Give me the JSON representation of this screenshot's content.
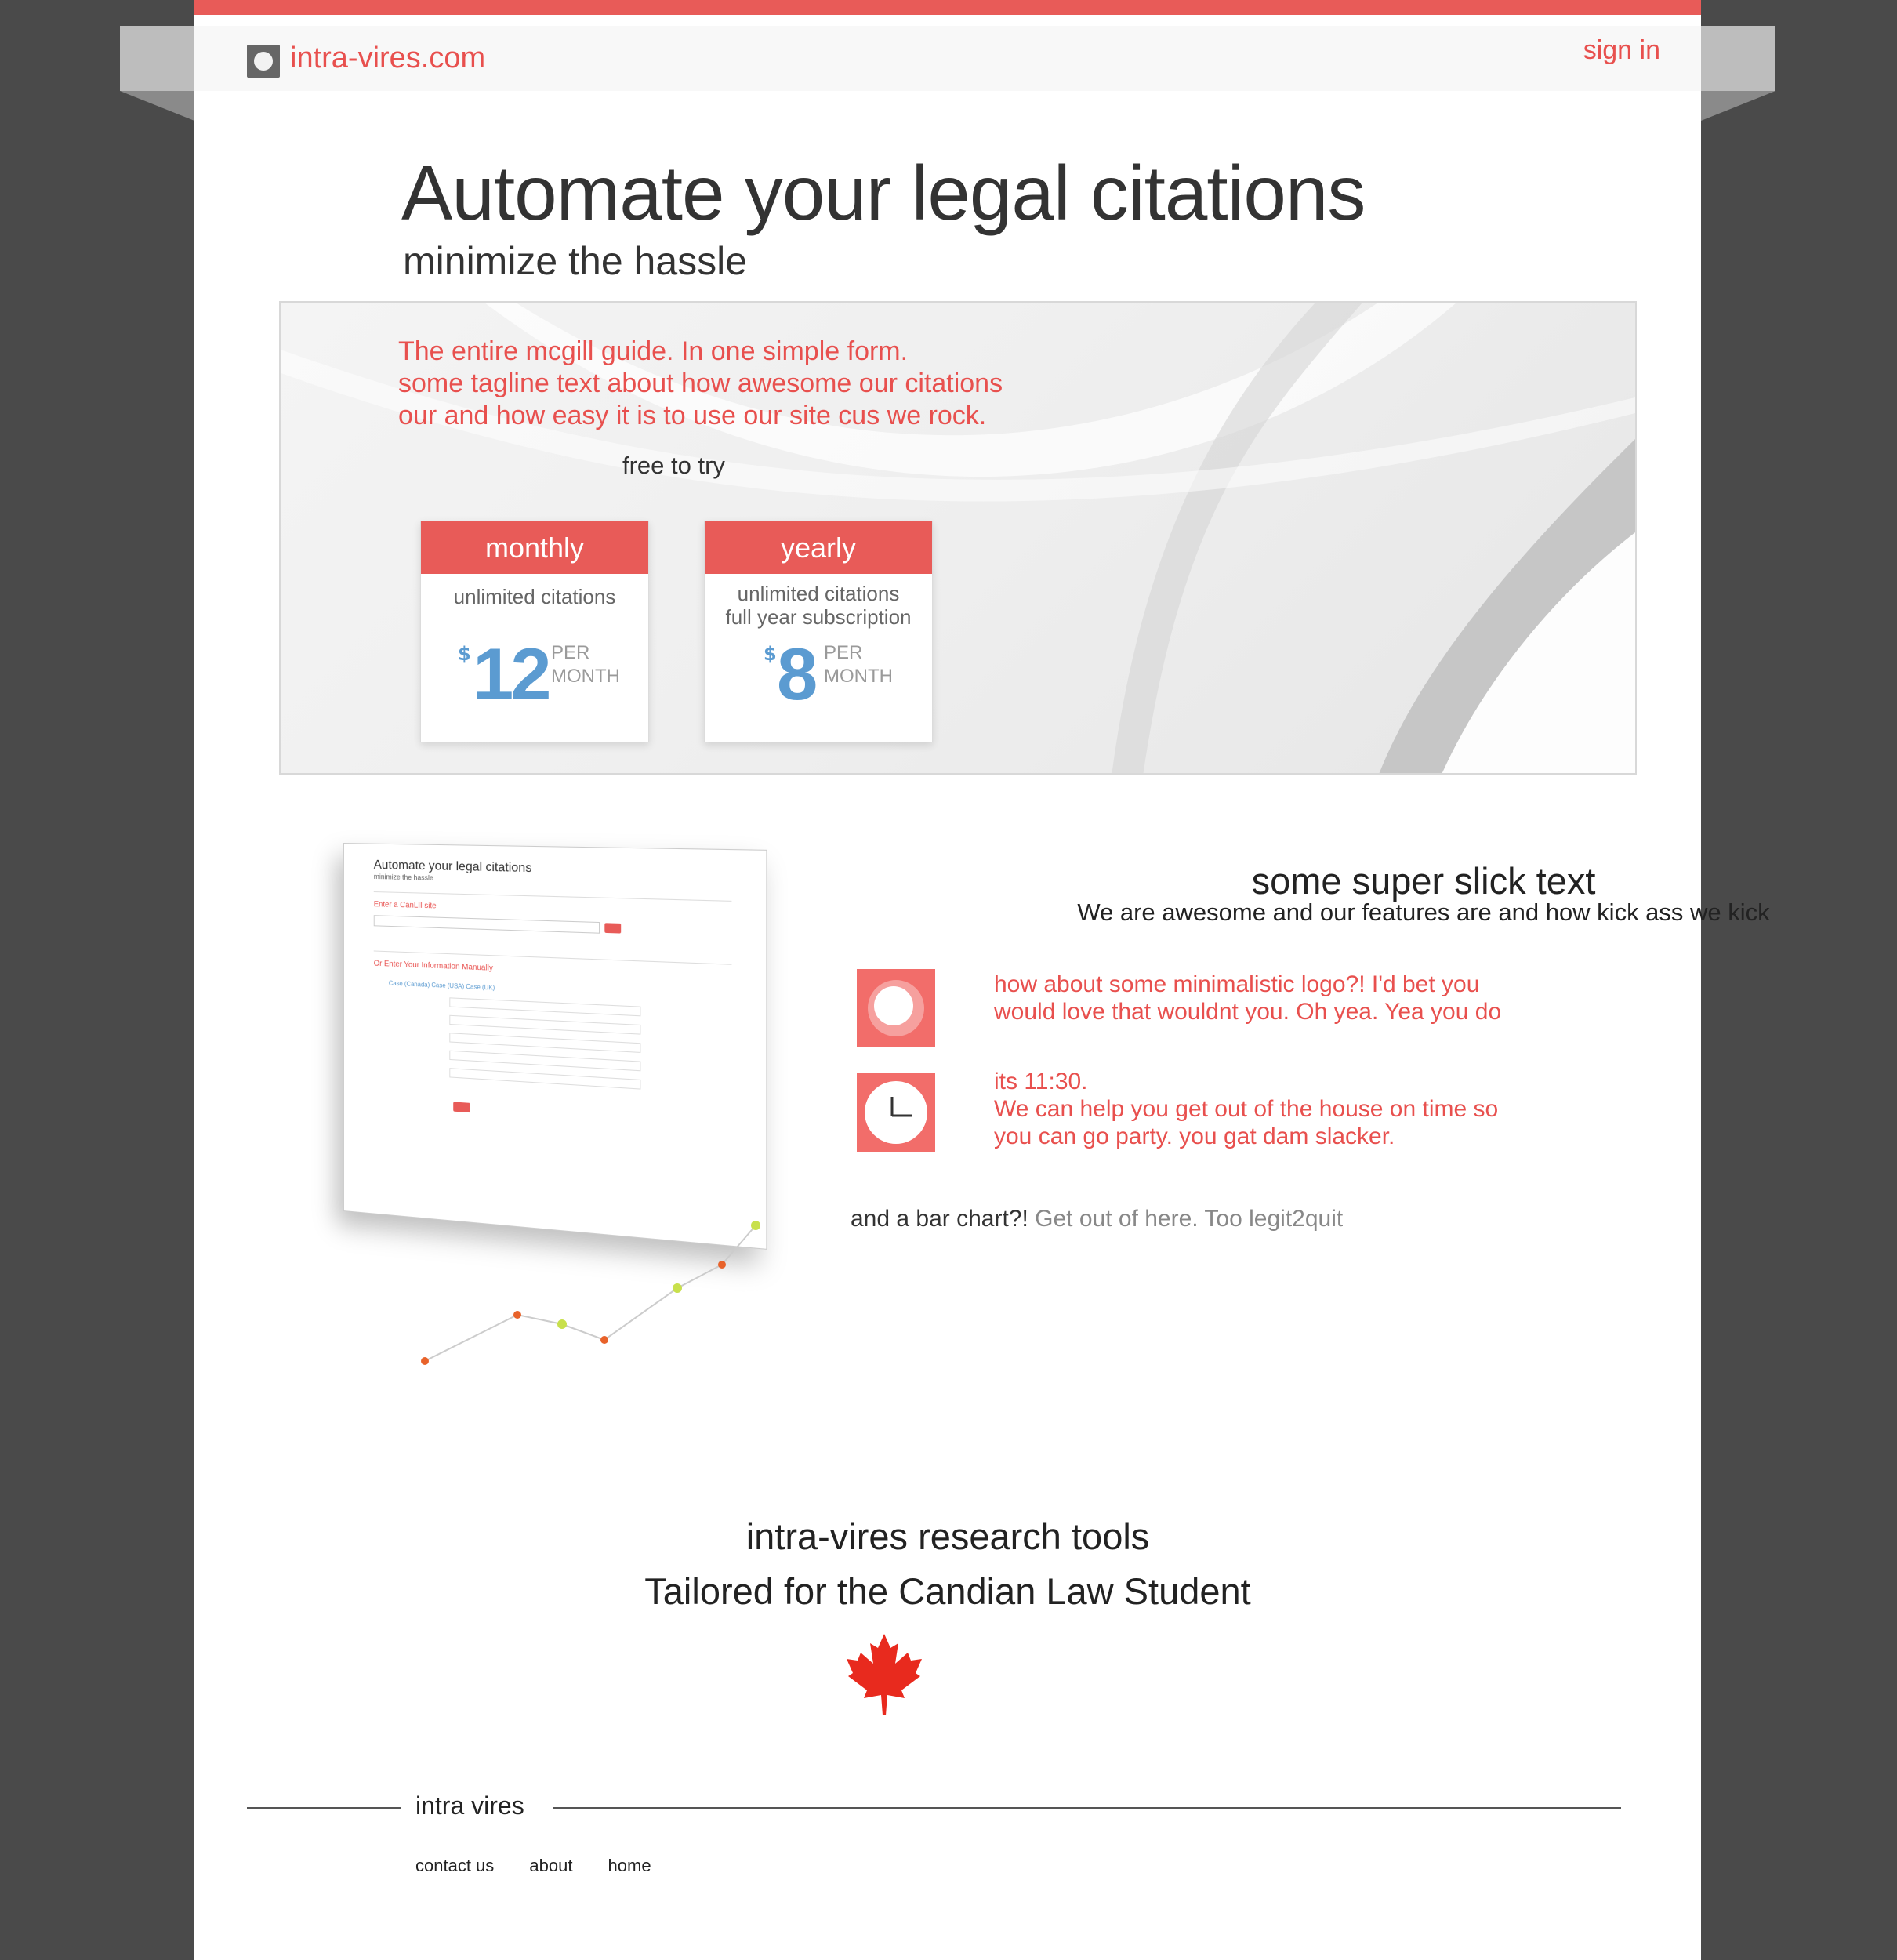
{
  "header": {
    "site_name": "intra-vires.com",
    "sign_in": "sign in"
  },
  "hero": {
    "title": "Automate your legal citations",
    "subtitle": "minimize the hassle"
  },
  "banner": {
    "tagline": [
      "The entire mcgill guide. In one simple form.",
      "some tagline text about how awesome our citations",
      "our and how easy it is to use our site cus we rock."
    ],
    "free_to_try": "free to try",
    "plans": [
      {
        "name": "monthly",
        "description": [
          "unlimited citations"
        ],
        "currency": "$",
        "price": "12",
        "per": "PER",
        "period": "MONTH"
      },
      {
        "name": "yearly",
        "description": [
          "unlimited citations",
          "full year subscription"
        ],
        "currency": "$",
        "price": "8",
        "per": "PER",
        "period": "MONTH"
      }
    ]
  },
  "mock_screenshot": {
    "title": "Automate your legal citations",
    "subtitle": "minimize the hassle",
    "canlii_label": "Enter a CanLII site",
    "manual_label": "Or Enter Your Information Manually",
    "tabs": "Case (Canada)   Case (USA)   Case (UK)"
  },
  "features": {
    "title": "some super slick text",
    "subtitle": "We are awesome and our features are and how kick ass we kick",
    "items": [
      {
        "icon": "minimal-logo-icon",
        "lines": [
          "how about some minimalistic logo?! I'd bet you",
          "would love that wouldnt you. Oh yea. Yea you do"
        ]
      },
      {
        "icon": "clock-icon",
        "lines": [
          "its 11:30.",
          "We can help you get out of the house on time so",
          "you can go party. you gat dam slacker."
        ]
      }
    ],
    "bar_chart_dark": "and a bar chart?!",
    "bar_chart_light": " Get out of here. Too legit2quit"
  },
  "tools": {
    "title": "intra-vires research tools",
    "subtitle": "Tailored for the Candian Law Student"
  },
  "footer": {
    "brand": "intra vires",
    "links": [
      "contact us",
      "about",
      "home"
    ]
  },
  "colors": {
    "accent": "#e85b58",
    "price_blue": "#5b9bd1",
    "background": "#4a4a4a"
  }
}
